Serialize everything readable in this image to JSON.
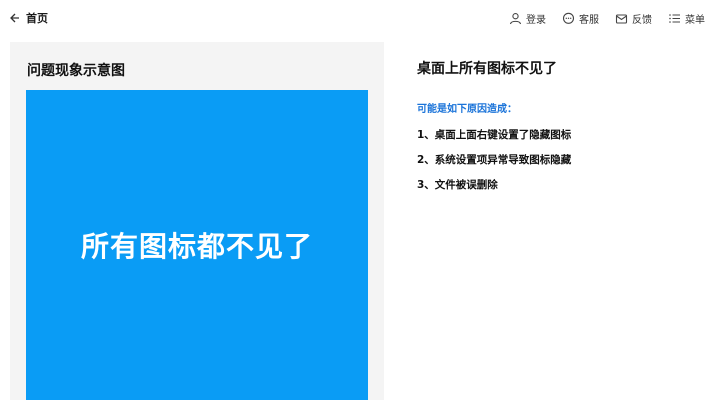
{
  "topbar": {
    "home_label": "首页",
    "actions": [
      {
        "label": "登录",
        "icon": "user-icon"
      },
      {
        "label": "客服",
        "icon": "chat-icon"
      },
      {
        "label": "反馈",
        "icon": "feedback-icon"
      },
      {
        "label": "菜单",
        "icon": "menu-icon"
      }
    ]
  },
  "left": {
    "title": "问题现象示意图",
    "illustration_text": "所有图标都不见了",
    "illustration_color": "#0a9cf5"
  },
  "right": {
    "title": "桌面上所有图标不见了",
    "cause_label": "可能是如下原因造成：",
    "causes": [
      "1、桌面上面右键设置了隐藏图标",
      "2、系统设置项异常导致图标隐藏",
      "3、文件被误删除"
    ]
  }
}
